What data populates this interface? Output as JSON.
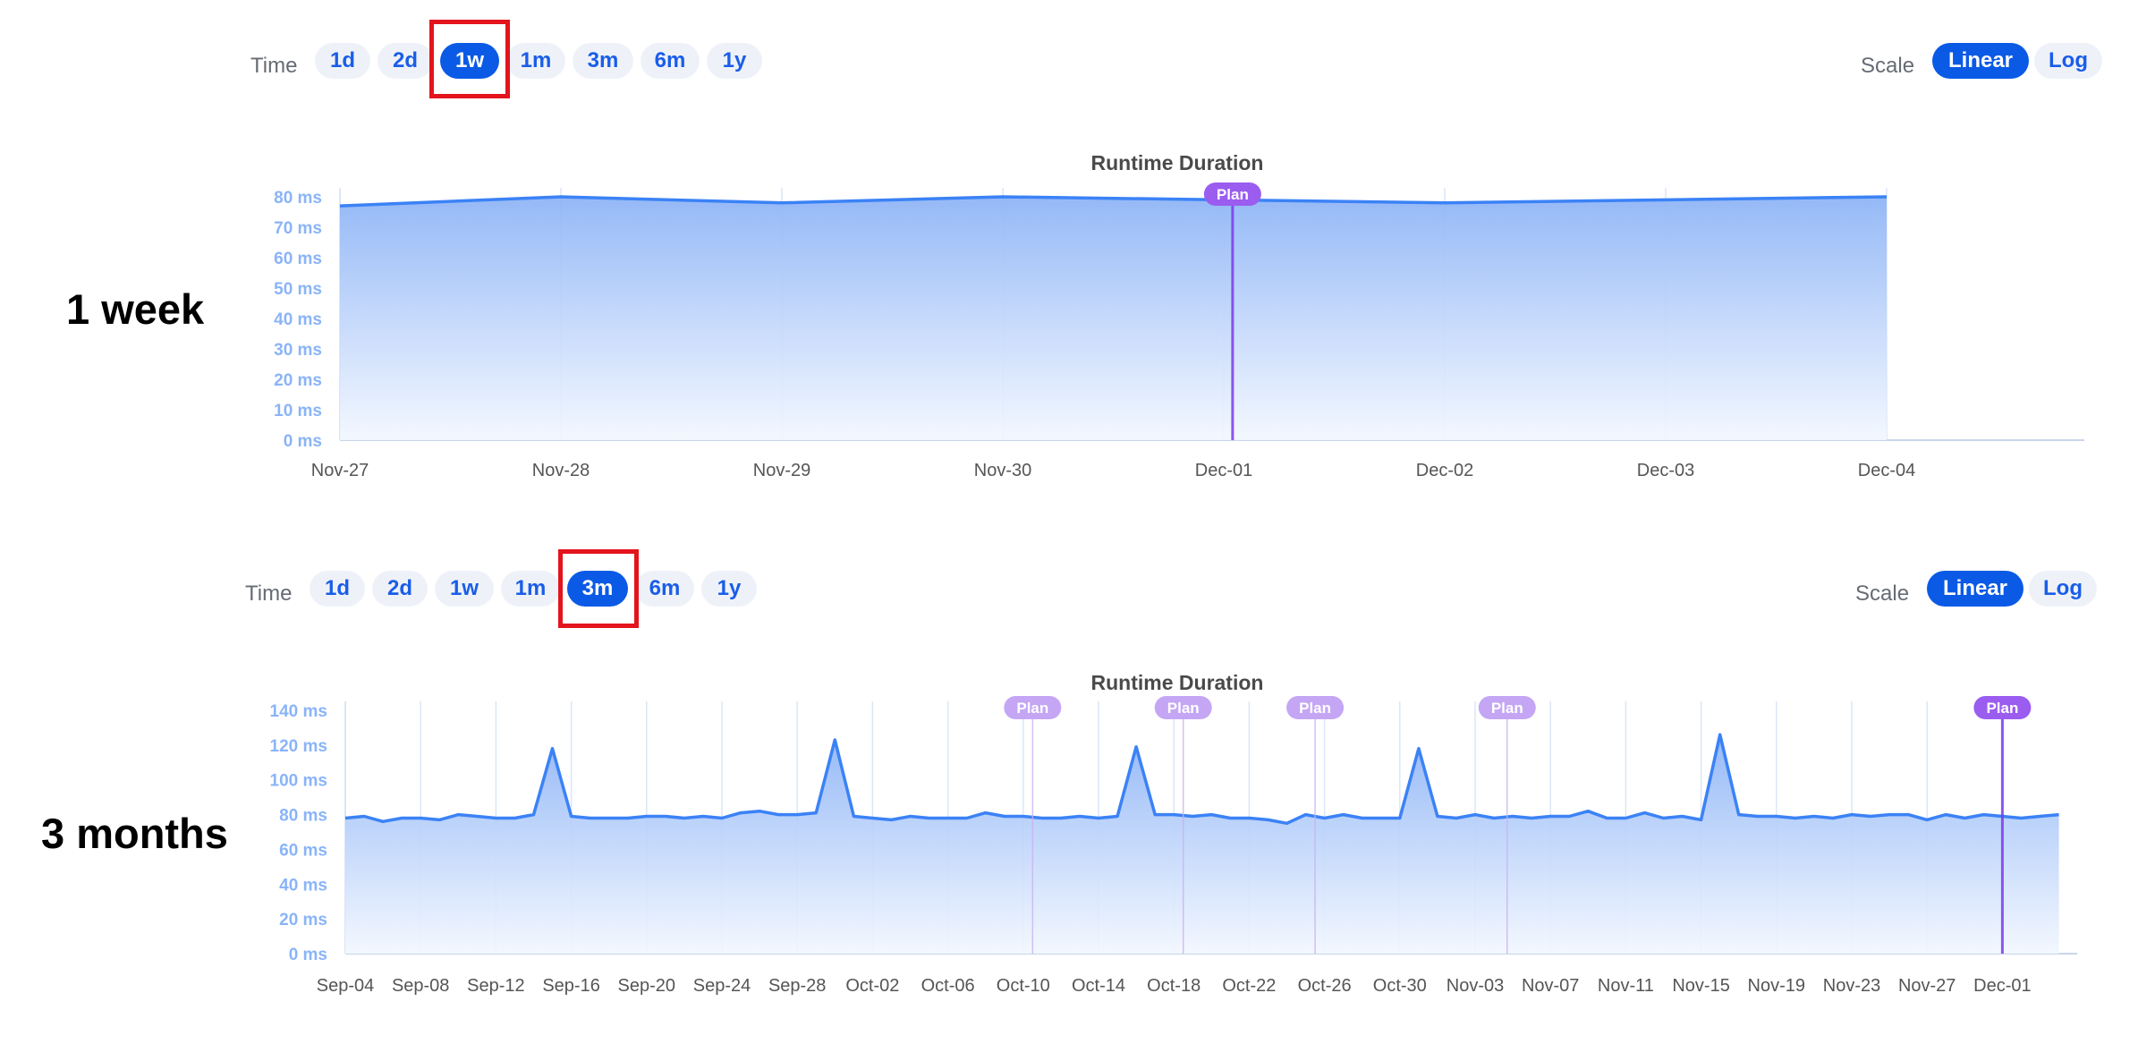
{
  "panels": [
    {
      "label": "1 week",
      "time_label": "Time",
      "time_options": [
        "1d",
        "2d",
        "1w",
        "1m",
        "3m",
        "6m",
        "1y"
      ],
      "time_selected": "1w",
      "scale_label": "Scale",
      "scale_options": [
        "Linear",
        "Log"
      ],
      "scale_selected": "Linear"
    },
    {
      "label": "3 months",
      "time_label": "Time",
      "time_options": [
        "1d",
        "2d",
        "1w",
        "1m",
        "3m",
        "6m",
        "1y"
      ],
      "time_selected": "3m",
      "scale_label": "Scale",
      "scale_options": [
        "Linear",
        "Log"
      ],
      "scale_selected": "Linear"
    }
  ],
  "colors": {
    "line": "#3b82f6",
    "area_top": "#8fb5f6",
    "area_bottom": "#f2f7ff",
    "axis_text": "#8ab4f8",
    "tick_text": "#555555",
    "plan_marker": "#7c3aed",
    "plan_badge_faded": "#c4a6f5",
    "plan_badge": "#9b5cf0",
    "selected_pill": "#0a5ae6",
    "highlight_box": "#e3141c"
  },
  "chart_data": [
    {
      "type": "area",
      "title": "Runtime Duration",
      "xlabel": "",
      "ylabel": "",
      "unit": "ms",
      "ylim": [
        0,
        80
      ],
      "yticks": [
        0,
        10,
        20,
        30,
        40,
        50,
        60,
        70,
        80
      ],
      "ytick_labels": [
        "0 ms",
        "10 ms",
        "20 ms",
        "30 ms",
        "40 ms",
        "50 ms",
        "60 ms",
        "70 ms",
        "80 ms"
      ],
      "xlim": [
        0,
        7.9
      ],
      "x_tick_labels": [
        "Nov-27",
        "Nov-28",
        "Nov-29",
        "Nov-30",
        "Dec-01",
        "Dec-02",
        "Dec-03",
        "Dec-04"
      ],
      "x": [
        0,
        1,
        2,
        3,
        4,
        5,
        6,
        7
      ],
      "series": [
        {
          "values": [
            77,
            80,
            78,
            80,
            79,
            78,
            79,
            80
          ]
        }
      ],
      "annotations": [
        {
          "label": "Plan",
          "x": 4.04,
          "style": "strong"
        }
      ],
      "grid": true
    },
    {
      "type": "area",
      "title": "Runtime Duration",
      "xlabel": "",
      "ylabel": "",
      "unit": "ms",
      "ylim": [
        0,
        140
      ],
      "yticks": [
        0,
        20,
        40,
        60,
        80,
        100,
        120,
        140
      ],
      "ytick_labels": [
        "0 ms",
        "20 ms",
        "40 ms",
        "60 ms",
        "80 ms",
        "100 ms",
        "120 ms",
        "140 ms"
      ],
      "xlim": [
        0,
        92
      ],
      "x_tick_labels": [
        "Sep-04",
        "Sep-08",
        "Sep-12",
        "Sep-16",
        "Sep-20",
        "Sep-24",
        "Sep-28",
        "Oct-02",
        "Oct-06",
        "Oct-10",
        "Oct-14",
        "Oct-18",
        "Oct-22",
        "Oct-26",
        "Oct-30",
        "Nov-03",
        "Nov-07",
        "Nov-11",
        "Nov-15",
        "Nov-19",
        "Nov-23",
        "Nov-27",
        "Dec-01"
      ],
      "x_tick_step": 4,
      "x": [
        0,
        1,
        2,
        3,
        4,
        5,
        6,
        7,
        8,
        9,
        10,
        11,
        12,
        13,
        14,
        15,
        16,
        17,
        18,
        19,
        20,
        21,
        22,
        23,
        24,
        25,
        26,
        27,
        28,
        29,
        30,
        31,
        32,
        33,
        34,
        35,
        36,
        37,
        38,
        39,
        40,
        41,
        42,
        43,
        44,
        45,
        46,
        47,
        48,
        49,
        50,
        51,
        52,
        53,
        54,
        55,
        56,
        57,
        58,
        59,
        60,
        61,
        62,
        63,
        64,
        65,
        66,
        67,
        68,
        69,
        70,
        71,
        72,
        73,
        74,
        75,
        76,
        77,
        78,
        79,
        80,
        81,
        82,
        83,
        84,
        85,
        86,
        87,
        88,
        89,
        90,
        91
      ],
      "series": [
        {
          "values": [
            78,
            79,
            76,
            78,
            78,
            77,
            80,
            79,
            78,
            78,
            80,
            118,
            79,
            78,
            78,
            78,
            79,
            79,
            78,
            79,
            78,
            81,
            82,
            80,
            80,
            81,
            123,
            79,
            78,
            77,
            79,
            78,
            78,
            78,
            81,
            79,
            79,
            78,
            78,
            79,
            78,
            79,
            119,
            80,
            80,
            79,
            80,
            78,
            78,
            77,
            75,
            80,
            78,
            80,
            78,
            78,
            78,
            118,
            79,
            78,
            80,
            78,
            79,
            78,
            79,
            79,
            82,
            78,
            78,
            81,
            78,
            79,
            77,
            126,
            80,
            79,
            79,
            78,
            79,
            78,
            80,
            79,
            80,
            80,
            77,
            80,
            78,
            80,
            79,
            78,
            79,
            80
          ]
        }
      ],
      "annotations": [
        {
          "label": "Plan",
          "x": 36.5,
          "style": "faded"
        },
        {
          "label": "Plan",
          "x": 44.5,
          "style": "faded"
        },
        {
          "label": "Plan",
          "x": 51.5,
          "style": "faded"
        },
        {
          "label": "Plan",
          "x": 61.7,
          "style": "faded"
        },
        {
          "label": "Plan",
          "x": 88.0,
          "style": "strong"
        }
      ],
      "grid": true
    }
  ]
}
